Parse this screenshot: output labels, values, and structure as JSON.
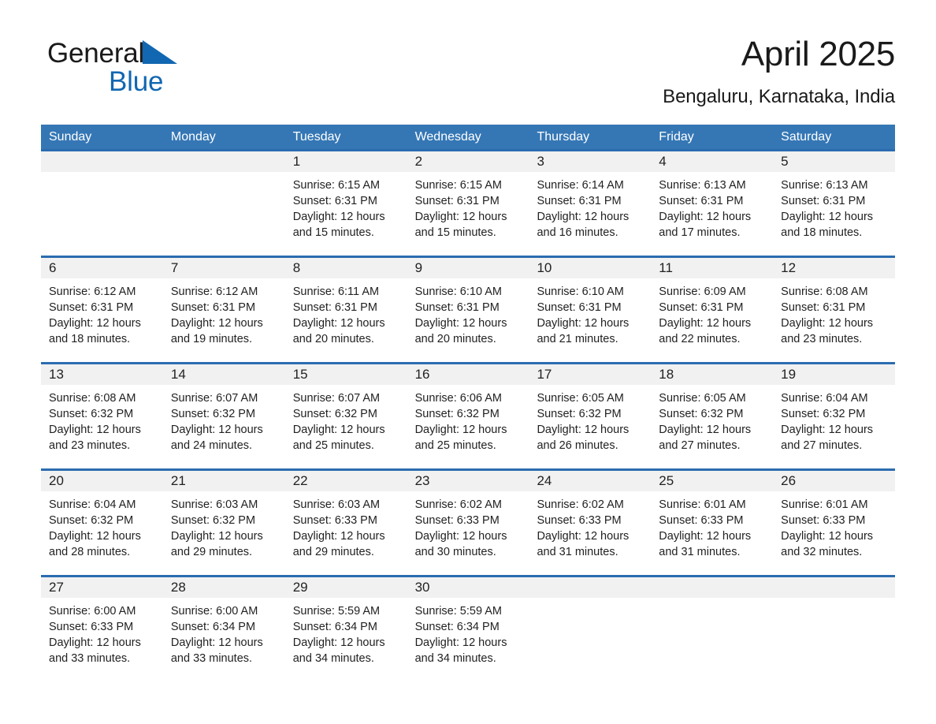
{
  "brand": {
    "name_part1": "General",
    "name_part2": "Blue",
    "triangle_icon": "brand-triangle-icon",
    "colors": {
      "blue": "#1167b1",
      "black": "#1a1a1a"
    }
  },
  "header": {
    "month_title": "April 2025",
    "location": "Bengaluru, Karnataka, India"
  },
  "theme": {
    "header_blue": "#3577b5",
    "rule_blue": "#2b6cb0",
    "daynum_band": "#f1f1f1",
    "text": "#222222"
  },
  "calendar": {
    "weekday_headers": [
      "Sunday",
      "Monday",
      "Tuesday",
      "Wednesday",
      "Thursday",
      "Friday",
      "Saturday"
    ],
    "weeks": [
      [
        {
          "day": "",
          "sunrise": "",
          "sunset": "",
          "daylight_line1": "",
          "daylight_line2": ""
        },
        {
          "day": "",
          "sunrise": "",
          "sunset": "",
          "daylight_line1": "",
          "daylight_line2": ""
        },
        {
          "day": "1",
          "sunrise": "Sunrise: 6:15 AM",
          "sunset": "Sunset: 6:31 PM",
          "daylight_line1": "Daylight: 12 hours",
          "daylight_line2": "and 15 minutes."
        },
        {
          "day": "2",
          "sunrise": "Sunrise: 6:15 AM",
          "sunset": "Sunset: 6:31 PM",
          "daylight_line1": "Daylight: 12 hours",
          "daylight_line2": "and 15 minutes."
        },
        {
          "day": "3",
          "sunrise": "Sunrise: 6:14 AM",
          "sunset": "Sunset: 6:31 PM",
          "daylight_line1": "Daylight: 12 hours",
          "daylight_line2": "and 16 minutes."
        },
        {
          "day": "4",
          "sunrise": "Sunrise: 6:13 AM",
          "sunset": "Sunset: 6:31 PM",
          "daylight_line1": "Daylight: 12 hours",
          "daylight_line2": "and 17 minutes."
        },
        {
          "day": "5",
          "sunrise": "Sunrise: 6:13 AM",
          "sunset": "Sunset: 6:31 PM",
          "daylight_line1": "Daylight: 12 hours",
          "daylight_line2": "and 18 minutes."
        }
      ],
      [
        {
          "day": "6",
          "sunrise": "Sunrise: 6:12 AM",
          "sunset": "Sunset: 6:31 PM",
          "daylight_line1": "Daylight: 12 hours",
          "daylight_line2": "and 18 minutes."
        },
        {
          "day": "7",
          "sunrise": "Sunrise: 6:12 AM",
          "sunset": "Sunset: 6:31 PM",
          "daylight_line1": "Daylight: 12 hours",
          "daylight_line2": "and 19 minutes."
        },
        {
          "day": "8",
          "sunrise": "Sunrise: 6:11 AM",
          "sunset": "Sunset: 6:31 PM",
          "daylight_line1": "Daylight: 12 hours",
          "daylight_line2": "and 20 minutes."
        },
        {
          "day": "9",
          "sunrise": "Sunrise: 6:10 AM",
          "sunset": "Sunset: 6:31 PM",
          "daylight_line1": "Daylight: 12 hours",
          "daylight_line2": "and 20 minutes."
        },
        {
          "day": "10",
          "sunrise": "Sunrise: 6:10 AM",
          "sunset": "Sunset: 6:31 PM",
          "daylight_line1": "Daylight: 12 hours",
          "daylight_line2": "and 21 minutes."
        },
        {
          "day": "11",
          "sunrise": "Sunrise: 6:09 AM",
          "sunset": "Sunset: 6:31 PM",
          "daylight_line1": "Daylight: 12 hours",
          "daylight_line2": "and 22 minutes."
        },
        {
          "day": "12",
          "sunrise": "Sunrise: 6:08 AM",
          "sunset": "Sunset: 6:31 PM",
          "daylight_line1": "Daylight: 12 hours",
          "daylight_line2": "and 23 minutes."
        }
      ],
      [
        {
          "day": "13",
          "sunrise": "Sunrise: 6:08 AM",
          "sunset": "Sunset: 6:32 PM",
          "daylight_line1": "Daylight: 12 hours",
          "daylight_line2": "and 23 minutes."
        },
        {
          "day": "14",
          "sunrise": "Sunrise: 6:07 AM",
          "sunset": "Sunset: 6:32 PM",
          "daylight_line1": "Daylight: 12 hours",
          "daylight_line2": "and 24 minutes."
        },
        {
          "day": "15",
          "sunrise": "Sunrise: 6:07 AM",
          "sunset": "Sunset: 6:32 PM",
          "daylight_line1": "Daylight: 12 hours",
          "daylight_line2": "and 25 minutes."
        },
        {
          "day": "16",
          "sunrise": "Sunrise: 6:06 AM",
          "sunset": "Sunset: 6:32 PM",
          "daylight_line1": "Daylight: 12 hours",
          "daylight_line2": "and 25 minutes."
        },
        {
          "day": "17",
          "sunrise": "Sunrise: 6:05 AM",
          "sunset": "Sunset: 6:32 PM",
          "daylight_line1": "Daylight: 12 hours",
          "daylight_line2": "and 26 minutes."
        },
        {
          "day": "18",
          "sunrise": "Sunrise: 6:05 AM",
          "sunset": "Sunset: 6:32 PM",
          "daylight_line1": "Daylight: 12 hours",
          "daylight_line2": "and 27 minutes."
        },
        {
          "day": "19",
          "sunrise": "Sunrise: 6:04 AM",
          "sunset": "Sunset: 6:32 PM",
          "daylight_line1": "Daylight: 12 hours",
          "daylight_line2": "and 27 minutes."
        }
      ],
      [
        {
          "day": "20",
          "sunrise": "Sunrise: 6:04 AM",
          "sunset": "Sunset: 6:32 PM",
          "daylight_line1": "Daylight: 12 hours",
          "daylight_line2": "and 28 minutes."
        },
        {
          "day": "21",
          "sunrise": "Sunrise: 6:03 AM",
          "sunset": "Sunset: 6:32 PM",
          "daylight_line1": "Daylight: 12 hours",
          "daylight_line2": "and 29 minutes."
        },
        {
          "day": "22",
          "sunrise": "Sunrise: 6:03 AM",
          "sunset": "Sunset: 6:33 PM",
          "daylight_line1": "Daylight: 12 hours",
          "daylight_line2": "and 29 minutes."
        },
        {
          "day": "23",
          "sunrise": "Sunrise: 6:02 AM",
          "sunset": "Sunset: 6:33 PM",
          "daylight_line1": "Daylight: 12 hours",
          "daylight_line2": "and 30 minutes."
        },
        {
          "day": "24",
          "sunrise": "Sunrise: 6:02 AM",
          "sunset": "Sunset: 6:33 PM",
          "daylight_line1": "Daylight: 12 hours",
          "daylight_line2": "and 31 minutes."
        },
        {
          "day": "25",
          "sunrise": "Sunrise: 6:01 AM",
          "sunset": "Sunset: 6:33 PM",
          "daylight_line1": "Daylight: 12 hours",
          "daylight_line2": "and 31 minutes."
        },
        {
          "day": "26",
          "sunrise": "Sunrise: 6:01 AM",
          "sunset": "Sunset: 6:33 PM",
          "daylight_line1": "Daylight: 12 hours",
          "daylight_line2": "and 32 minutes."
        }
      ],
      [
        {
          "day": "27",
          "sunrise": "Sunrise: 6:00 AM",
          "sunset": "Sunset: 6:33 PM",
          "daylight_line1": "Daylight: 12 hours",
          "daylight_line2": "and 33 minutes."
        },
        {
          "day": "28",
          "sunrise": "Sunrise: 6:00 AM",
          "sunset": "Sunset: 6:34 PM",
          "daylight_line1": "Daylight: 12 hours",
          "daylight_line2": "and 33 minutes."
        },
        {
          "day": "29",
          "sunrise": "Sunrise: 5:59 AM",
          "sunset": "Sunset: 6:34 PM",
          "daylight_line1": "Daylight: 12 hours",
          "daylight_line2": "and 34 minutes."
        },
        {
          "day": "30",
          "sunrise": "Sunrise: 5:59 AM",
          "sunset": "Sunset: 6:34 PM",
          "daylight_line1": "Daylight: 12 hours",
          "daylight_line2": "and 34 minutes."
        },
        {
          "day": "",
          "sunrise": "",
          "sunset": "",
          "daylight_line1": "",
          "daylight_line2": ""
        },
        {
          "day": "",
          "sunrise": "",
          "sunset": "",
          "daylight_line1": "",
          "daylight_line2": ""
        },
        {
          "day": "",
          "sunrise": "",
          "sunset": "",
          "daylight_line1": "",
          "daylight_line2": ""
        }
      ]
    ]
  }
}
